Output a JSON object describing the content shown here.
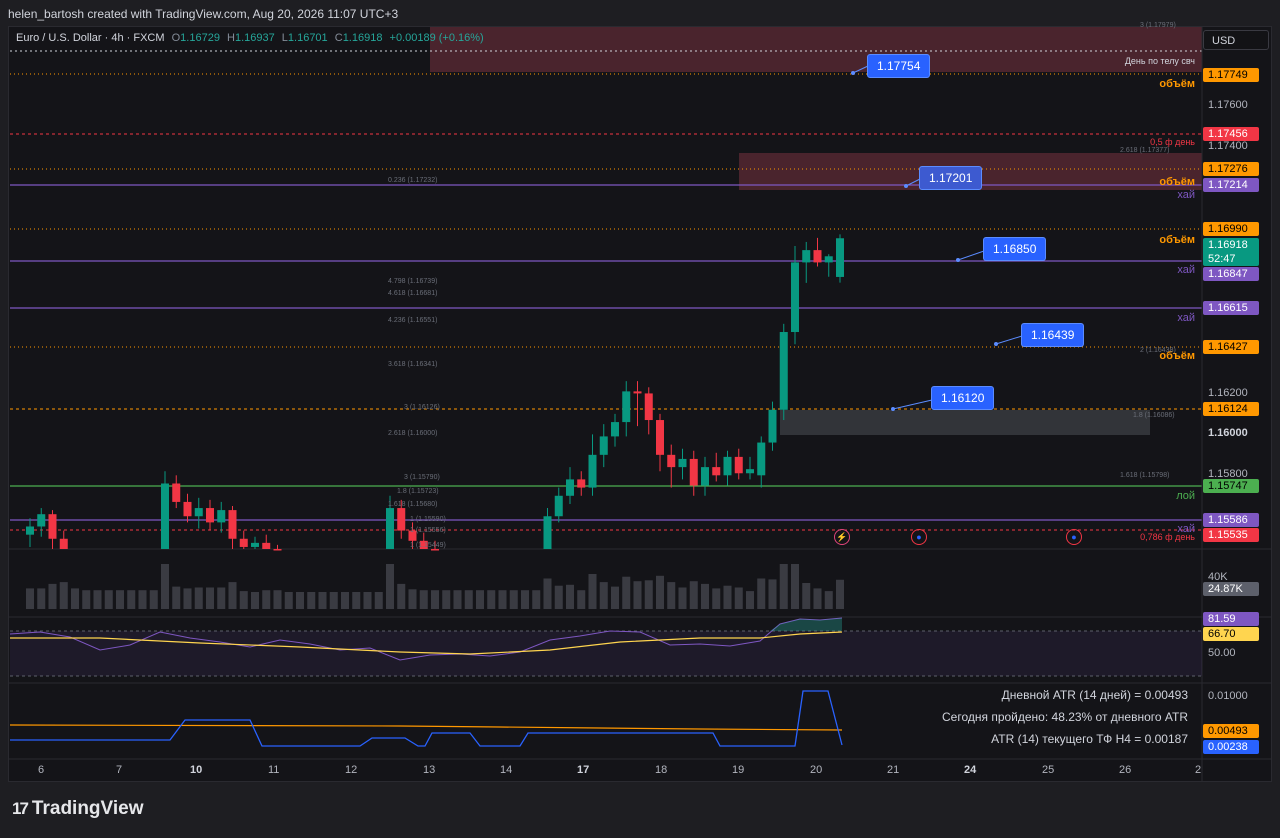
{
  "credit": "helen_bartosh created with TradingView.com, Aug 20, 2026 11:07 UTC+3",
  "legend": {
    "symbol": "Euro / U.S. Dollar · 4h · FXCM",
    "o_label": "O",
    "o": "1.16729",
    "h_label": "H",
    "h": "1.16937",
    "l_label": "L",
    "l": "1.16701",
    "c_label": "C",
    "c": "1.16918",
    "change": "+0.00189 (+0.16%)"
  },
  "currency_button": "USD",
  "price_axis": {
    "grid_labels": [
      "1.17600",
      "1.17400",
      "1.16200",
      "1.16000",
      "1.15800"
    ],
    "tags": [
      {
        "text": "1.17749",
        "color": "#ff9800"
      },
      {
        "text": "1.17456",
        "color": "#f23645"
      },
      {
        "text": "1.17276",
        "color": "#ff9800"
      },
      {
        "text": "1.17214",
        "color": "#7e57c2"
      },
      {
        "text": "1.16990",
        "color": "#ff9800"
      },
      {
        "text": "1.16918",
        "color": "#089981"
      },
      {
        "text": "52:47",
        "color": "#089981"
      },
      {
        "text": "1.16847",
        "color": "#7e57c2"
      },
      {
        "text": "1.16615",
        "color": "#7e57c2"
      },
      {
        "text": "1.16427",
        "color": "#ff9800"
      },
      {
        "text": "1.16124",
        "color": "#ff9800"
      },
      {
        "text": "1.15747",
        "color": "#4caf50"
      },
      {
        "text": "1.15586",
        "color": "#7e57c2"
      },
      {
        "text": "1.15535",
        "color": "#f23645"
      },
      {
        "text": "24.87K",
        "color": "#5d606b"
      },
      {
        "text": "81.59",
        "color": "#7e57c2"
      },
      {
        "text": "66.70",
        "color": "#ffd54f"
      },
      {
        "text": "0.00493",
        "color": "#ff9800"
      },
      {
        "text": "0.00238",
        "color": "#2962ff"
      }
    ],
    "volume_label": "40K",
    "rsi_label": "50.00",
    "atr_label": "0.01000"
  },
  "callouts": [
    "1.17754",
    "1.17201",
    "1.16850",
    "1.16439",
    "1.16120"
  ],
  "side_labels": {
    "obiem": "объём",
    "hai": "хай",
    "loi": "лой",
    "f05": "0,5 ф день",
    "f0786": "0,786 ф день",
    "den_po_telu": "День по телу свч"
  },
  "fib_labels": [
    "3 (1.17979)",
    "2.618 (1.17377)",
    "0.236 (1.17232)",
    "4.798 (1.16739)",
    "4.618 (1.16681)",
    "4.236 (1.16551)",
    "2 (1.16438)",
    "3.618 (1.16341)",
    "3 (1.16126)",
    "1.8 (1.16086)",
    "2.618 (1.16000)",
    "3 (1.15790)",
    "1.618 (1.15798)",
    "1.8 (1.15723)",
    "1.618 (1.15680)",
    "1 (1.15590)",
    "1 (1.15556)",
    "1 (1.15449)"
  ],
  "atr_text": {
    "daily": "Дневной ATR (14 дней) = 0.00493",
    "passed": "Сегодня пройдено: 48.23% от дневного ATR",
    "current": "ATR (14) текущего ТФ H4 = 0.00187"
  },
  "time_axis": [
    "6",
    "7",
    "10",
    "11",
    "12",
    "13",
    "14",
    "17",
    "18",
    "19",
    "20",
    "21",
    "24",
    "25",
    "26",
    "2"
  ],
  "brand": "TradingView",
  "colors": {
    "up": "#089981",
    "down": "#f23645",
    "accent": "#2962ff",
    "orange": "#ff9800",
    "purple": "#7e57c2"
  },
  "chart_data": {
    "type": "candlestick",
    "candles": [
      {
        "o": 1.1547,
        "h": 1.1555,
        "l": 1.1541,
        "c": 1.1551
      },
      {
        "o": 1.1551,
        "h": 1.156,
        "l": 1.1546,
        "c": 1.1557
      },
      {
        "o": 1.1557,
        "h": 1.1559,
        "l": 1.154,
        "c": 1.1545
      },
      {
        "o": 1.1545,
        "h": 1.1549,
        "l": 1.1528,
        "c": 1.1533
      },
      {
        "o": 1.1533,
        "h": 1.154,
        "l": 1.1526,
        "c": 1.153
      },
      {
        "o": 1.153,
        "h": 1.1536,
        "l": 1.1524,
        "c": 1.1528
      },
      {
        "o": 1.1528,
        "h": 1.1534,
        "l": 1.1522,
        "c": 1.1526
      },
      {
        "o": 1.1526,
        "h": 1.1532,
        "l": 1.152,
        "c": 1.1524
      },
      {
        "o": 1.1524,
        "h": 1.153,
        "l": 1.1518,
        "c": 1.1522
      },
      {
        "o": 1.1522,
        "h": 1.1528,
        "l": 1.1516,
        "c": 1.152
      },
      {
        "o": 1.152,
        "h": 1.1526,
        "l": 1.1514,
        "c": 1.1518
      },
      {
        "o": 1.1518,
        "h": 1.1524,
        "l": 1.1512,
        "c": 1.1516
      },
      {
        "o": 1.153,
        "h": 1.1578,
        "l": 1.1525,
        "c": 1.1572
      },
      {
        "o": 1.1572,
        "h": 1.1576,
        "l": 1.156,
        "c": 1.1563
      },
      {
        "o": 1.1563,
        "h": 1.1567,
        "l": 1.1553,
        "c": 1.1556
      },
      {
        "o": 1.1556,
        "h": 1.1565,
        "l": 1.155,
        "c": 1.156
      },
      {
        "o": 1.156,
        "h": 1.1564,
        "l": 1.1549,
        "c": 1.1553
      },
      {
        "o": 1.1553,
        "h": 1.1563,
        "l": 1.1548,
        "c": 1.1559
      },
      {
        "o": 1.1559,
        "h": 1.1561,
        "l": 1.154,
        "c": 1.1545
      },
      {
        "o": 1.1545,
        "h": 1.1549,
        "l": 1.1538,
        "c": 1.1541
      },
      {
        "o": 1.1541,
        "h": 1.1546,
        "l": 1.1536,
        "c": 1.1543
      },
      {
        "o": 1.1543,
        "h": 1.1547,
        "l": 1.1535,
        "c": 1.1538
      },
      {
        "o": 1.1538,
        "h": 1.1542,
        "l": 1.153,
        "c": 1.1534
      },
      {
        "o": 1.1534,
        "h": 1.1538,
        "l": 1.1528,
        "c": 1.1532
      },
      {
        "o": 1.1532,
        "h": 1.1536,
        "l": 1.1526,
        "c": 1.153
      },
      {
        "o": 1.153,
        "h": 1.1534,
        "l": 1.1524,
        "c": 1.1528
      },
      {
        "o": 1.1528,
        "h": 1.1532,
        "l": 1.1522,
        "c": 1.1526
      },
      {
        "o": 1.1526,
        "h": 1.153,
        "l": 1.152,
        "c": 1.1524
      },
      {
        "o": 1.1524,
        "h": 1.1528,
        "l": 1.1518,
        "c": 1.1522
      },
      {
        "o": 1.1522,
        "h": 1.1526,
        "l": 1.1516,
        "c": 1.152
      },
      {
        "o": 1.152,
        "h": 1.1524,
        "l": 1.1514,
        "c": 1.1518
      },
      {
        "o": 1.1518,
        "h": 1.1522,
        "l": 1.1512,
        "c": 1.1516
      },
      {
        "o": 1.1518,
        "h": 1.1566,
        "l": 1.1514,
        "c": 1.156
      },
      {
        "o": 1.156,
        "h": 1.1564,
        "l": 1.1545,
        "c": 1.1549
      },
      {
        "o": 1.1549,
        "h": 1.1553,
        "l": 1.154,
        "c": 1.1544
      },
      {
        "o": 1.1544,
        "h": 1.1548,
        "l": 1.1536,
        "c": 1.154
      },
      {
        "o": 1.154,
        "h": 1.1544,
        "l": 1.1532,
        "c": 1.1536
      },
      {
        "o": 1.1536,
        "h": 1.154,
        "l": 1.1528,
        "c": 1.1532
      },
      {
        "o": 1.1532,
        "h": 1.1536,
        "l": 1.1524,
        "c": 1.1528
      },
      {
        "o": 1.1528,
        "h": 1.1532,
        "l": 1.152,
        "c": 1.1524
      },
      {
        "o": 1.1524,
        "h": 1.1528,
        "l": 1.1516,
        "c": 1.152
      },
      {
        "o": 1.152,
        "h": 1.1524,
        "l": 1.1512,
        "c": 1.1516
      },
      {
        "o": 1.1516,
        "h": 1.152,
        "l": 1.1508,
        "c": 1.1512
      },
      {
        "o": 1.1512,
        "h": 1.1516,
        "l": 1.1504,
        "c": 1.1508
      },
      {
        "o": 1.1508,
        "h": 1.1512,
        "l": 1.15,
        "c": 1.1504
      },
      {
        "o": 1.1504,
        "h": 1.1508,
        "l": 1.1496,
        "c": 1.15
      },
      {
        "o": 1.1538,
        "h": 1.156,
        "l": 1.1535,
        "c": 1.1556
      },
      {
        "o": 1.1556,
        "h": 1.157,
        "l": 1.1553,
        "c": 1.1566
      },
      {
        "o": 1.1566,
        "h": 1.158,
        "l": 1.1562,
        "c": 1.1574
      },
      {
        "o": 1.1574,
        "h": 1.1578,
        "l": 1.1566,
        "c": 1.157
      },
      {
        "o": 1.157,
        "h": 1.1596,
        "l": 1.1566,
        "c": 1.1586
      },
      {
        "o": 1.1586,
        "h": 1.1601,
        "l": 1.158,
        "c": 1.1595
      },
      {
        "o": 1.1595,
        "h": 1.1606,
        "l": 1.159,
        "c": 1.1602
      },
      {
        "o": 1.1602,
        "h": 1.1622,
        "l": 1.1595,
        "c": 1.1617
      },
      {
        "o": 1.1617,
        "h": 1.1622,
        "l": 1.16,
        "c": 1.1616
      },
      {
        "o": 1.1616,
        "h": 1.1619,
        "l": 1.1596,
        "c": 1.1603
      },
      {
        "o": 1.1603,
        "h": 1.1606,
        "l": 1.1578,
        "c": 1.1586
      },
      {
        "o": 1.1586,
        "h": 1.1591,
        "l": 1.157,
        "c": 1.158
      },
      {
        "o": 1.158,
        "h": 1.1589,
        "l": 1.1574,
        "c": 1.1584
      },
      {
        "o": 1.1584,
        "h": 1.1588,
        "l": 1.1566,
        "c": 1.1571
      },
      {
        "o": 1.1571,
        "h": 1.1585,
        "l": 1.1566,
        "c": 1.158
      },
      {
        "o": 1.158,
        "h": 1.1587,
        "l": 1.1573,
        "c": 1.1576
      },
      {
        "o": 1.1576,
        "h": 1.1588,
        "l": 1.1571,
        "c": 1.1585
      },
      {
        "o": 1.1585,
        "h": 1.1589,
        "l": 1.1574,
        "c": 1.1577
      },
      {
        "o": 1.1577,
        "h": 1.1585,
        "l": 1.1574,
        "c": 1.1579
      },
      {
        "o": 1.1576,
        "h": 1.1595,
        "l": 1.157,
        "c": 1.1592
      },
      {
        "o": 1.1592,
        "h": 1.1612,
        "l": 1.1588,
        "c": 1.1608
      },
      {
        "o": 1.1608,
        "h": 1.165,
        "l": 1.1603,
        "c": 1.1646
      },
      {
        "o": 1.1646,
        "h": 1.1688,
        "l": 1.164,
        "c": 1.168
      },
      {
        "o": 1.168,
        "h": 1.169,
        "l": 1.167,
        "c": 1.1686
      },
      {
        "o": 1.1686,
        "h": 1.1692,
        "l": 1.1678,
        "c": 1.168
      },
      {
        "o": 1.168,
        "h": 1.1684,
        "l": 1.1673,
        "c": 1.1683
      },
      {
        "o": 1.16729,
        "h": 1.16937,
        "l": 1.16701,
        "c": 1.16918
      }
    ]
  }
}
